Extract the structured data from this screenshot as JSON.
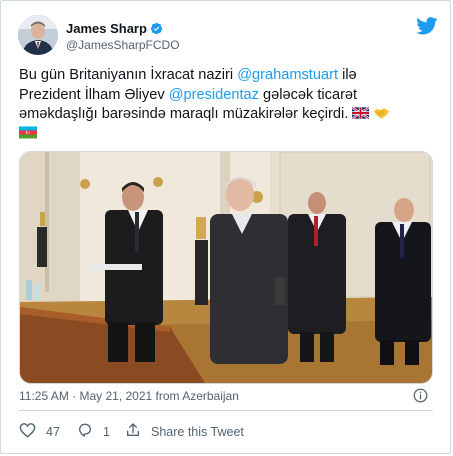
{
  "author": {
    "name": "James Sharp",
    "handle": "@JamesSharpFCDO",
    "verified": true
  },
  "tweet": {
    "line1_a": "Bu gün Britaniyanın İxracat naziri ",
    "line1_mention": "@grahamstuart",
    "line1_b": " ilə",
    "line2_a": "Prezident İlham Əliyev ",
    "line2_mention": "@presidentaz",
    "line2_b": " gələcək ticarət",
    "line3": "əməkdaşlığı barəsində maraqlı müzakirələr keçirdi. ",
    "emoji": [
      "uk-flag",
      "handshake",
      "azerbaijan-flag"
    ]
  },
  "meta": {
    "timestamp": "11:25 AM · May 21, 2021 from Azerbaijan"
  },
  "actions": {
    "likes": "47",
    "replies": "1",
    "share_label": "Share this Tweet"
  },
  "colors": {
    "link": "#1d9bf0",
    "text": "#0f1419",
    "muted": "#536471",
    "border": "#cfd9de"
  }
}
